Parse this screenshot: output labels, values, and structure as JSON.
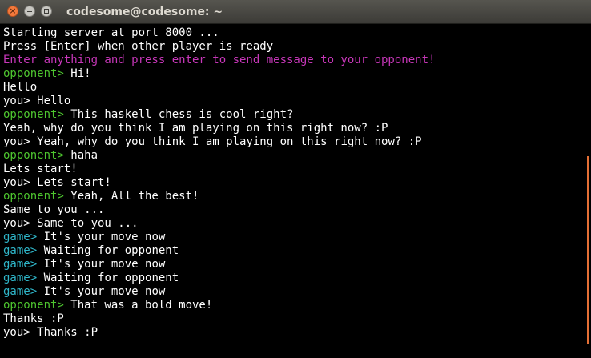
{
  "window": {
    "title": "codesome@codesome: ~",
    "close_glyph": "×"
  },
  "terminal": {
    "lines": [
      {
        "prompt": "",
        "text": "Starting server at port 8000 ..."
      },
      {
        "prompt": "",
        "text": "Press [Enter] when other player is ready"
      },
      {
        "prompt": "",
        "text": "Enter anything and press enter to send message to your opponent!",
        "style": "magenta"
      },
      {
        "prompt": "opponent>",
        "text": " Hi!"
      },
      {
        "prompt": "",
        "text": "Hello"
      },
      {
        "prompt": "you>",
        "text": " Hello"
      },
      {
        "prompt": "opponent>",
        "text": " This haskell chess is cool right?"
      },
      {
        "prompt": "",
        "text": "Yeah, why do you think I am playing on this right now? :P"
      },
      {
        "prompt": "you>",
        "text": " Yeah, why do you think I am playing on this right now? :P"
      },
      {
        "prompt": "opponent>",
        "text": " haha"
      },
      {
        "prompt": "",
        "text": "Lets start!"
      },
      {
        "prompt": "you>",
        "text": " Lets start!"
      },
      {
        "prompt": "opponent>",
        "text": " Yeah, All the best!"
      },
      {
        "prompt": "",
        "text": "Same to you ..."
      },
      {
        "prompt": "you>",
        "text": " Same to you ..."
      },
      {
        "prompt": "game>",
        "text": " It's your move now"
      },
      {
        "prompt": "game>",
        "text": " Waiting for opponent"
      },
      {
        "prompt": "game>",
        "text": " It's your move now"
      },
      {
        "prompt": "game>",
        "text": " Waiting for opponent"
      },
      {
        "prompt": "game>",
        "text": " It's your move now"
      },
      {
        "prompt": "opponent>",
        "text": " That was a bold move!"
      },
      {
        "prompt": "",
        "text": "Thanks :P"
      },
      {
        "prompt": "you>",
        "text": " Thanks :P"
      }
    ]
  },
  "colors": {
    "background": "#000000",
    "titlebar": "#3c3b37",
    "opponent_prompt": "#4ec62f",
    "game_prompt": "#2fb6c9",
    "notice_text": "#c837ba",
    "scrollbar": "#e46f35"
  }
}
